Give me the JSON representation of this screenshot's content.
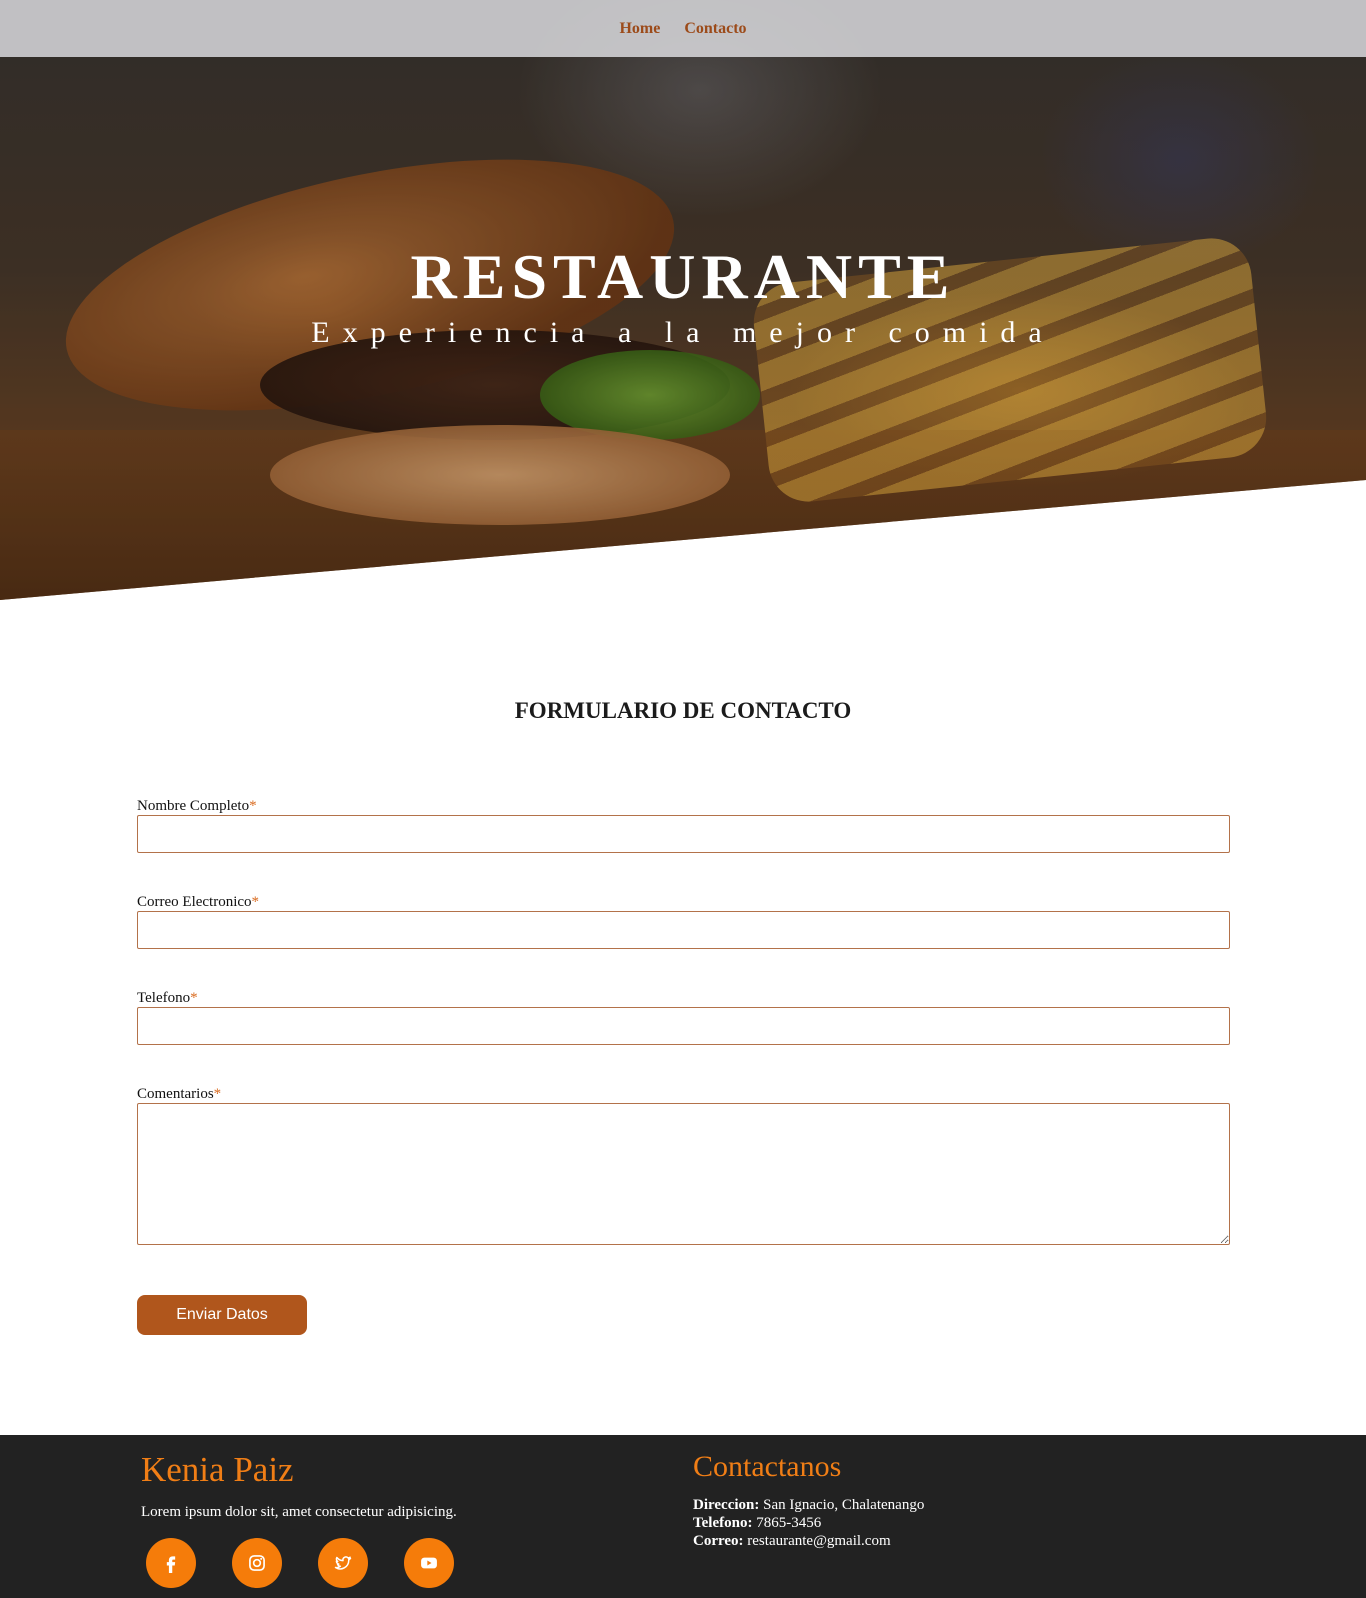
{
  "nav": {
    "items": [
      {
        "label": "Home"
      },
      {
        "label": "Contacto"
      }
    ]
  },
  "hero": {
    "title": "RESTAURANTE",
    "subtitle": "Experiencia a la mejor comida"
  },
  "form": {
    "title": "FORMULARIO DE CONTACTO",
    "required_mark": "*",
    "fields": [
      {
        "label": "Nombre Completo",
        "value": ""
      },
      {
        "label": "Correo Electronico",
        "value": ""
      },
      {
        "label": "Telefono",
        "value": ""
      },
      {
        "label": "Comentarios",
        "value": ""
      }
    ],
    "submit_label": "Enviar Datos"
  },
  "footer": {
    "name": "Kenia Paiz",
    "description": "Lorem ipsum dolor sit, amet consectetur adipisicing.",
    "socials": [
      {
        "icon": "facebook-icon"
      },
      {
        "icon": "instagram-icon"
      },
      {
        "icon": "twitter-icon"
      },
      {
        "icon": "youtube-icon"
      }
    ],
    "contact_title": "Contactanos",
    "contact": {
      "address_label": "Direccion:",
      "address": "San Ignacio, Chalatenango",
      "phone_label": "Telefono:",
      "phone": "7865-3456",
      "email_label": "Correo:",
      "email": "restaurante@gmail.com"
    }
  },
  "colors": {
    "accent": "#f57c0a",
    "button": "#b0561c",
    "nav_link": "#9c4b1a",
    "footer_bg": "#222222",
    "input_border": "#b3724a"
  }
}
